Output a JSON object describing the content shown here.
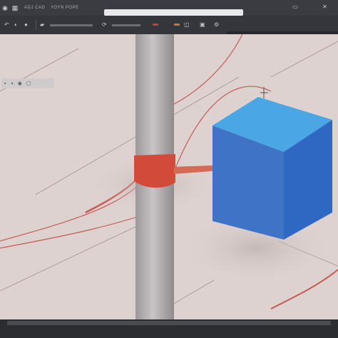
{
  "tabs": [
    {
      "label": "ADJ CAD"
    },
    {
      "label": "ΥΟΥΝ ΡΟΡΕ"
    }
  ],
  "icons": {
    "app": "app-logo-icon",
    "tools": [
      "select-icon",
      "move-icon",
      "rotate-icon",
      "scale-icon",
      "camera-icon"
    ],
    "window": [
      "minimize-icon",
      "close-icon"
    ]
  },
  "colors": {
    "viewport_bg": "#ddd2cf",
    "cube_front": "#3f73c6",
    "cube_top": "#4aa6e4",
    "cube_side": "#2f68c2",
    "pillar": "#b9b4b5",
    "accent_red": "#d24a3a"
  }
}
